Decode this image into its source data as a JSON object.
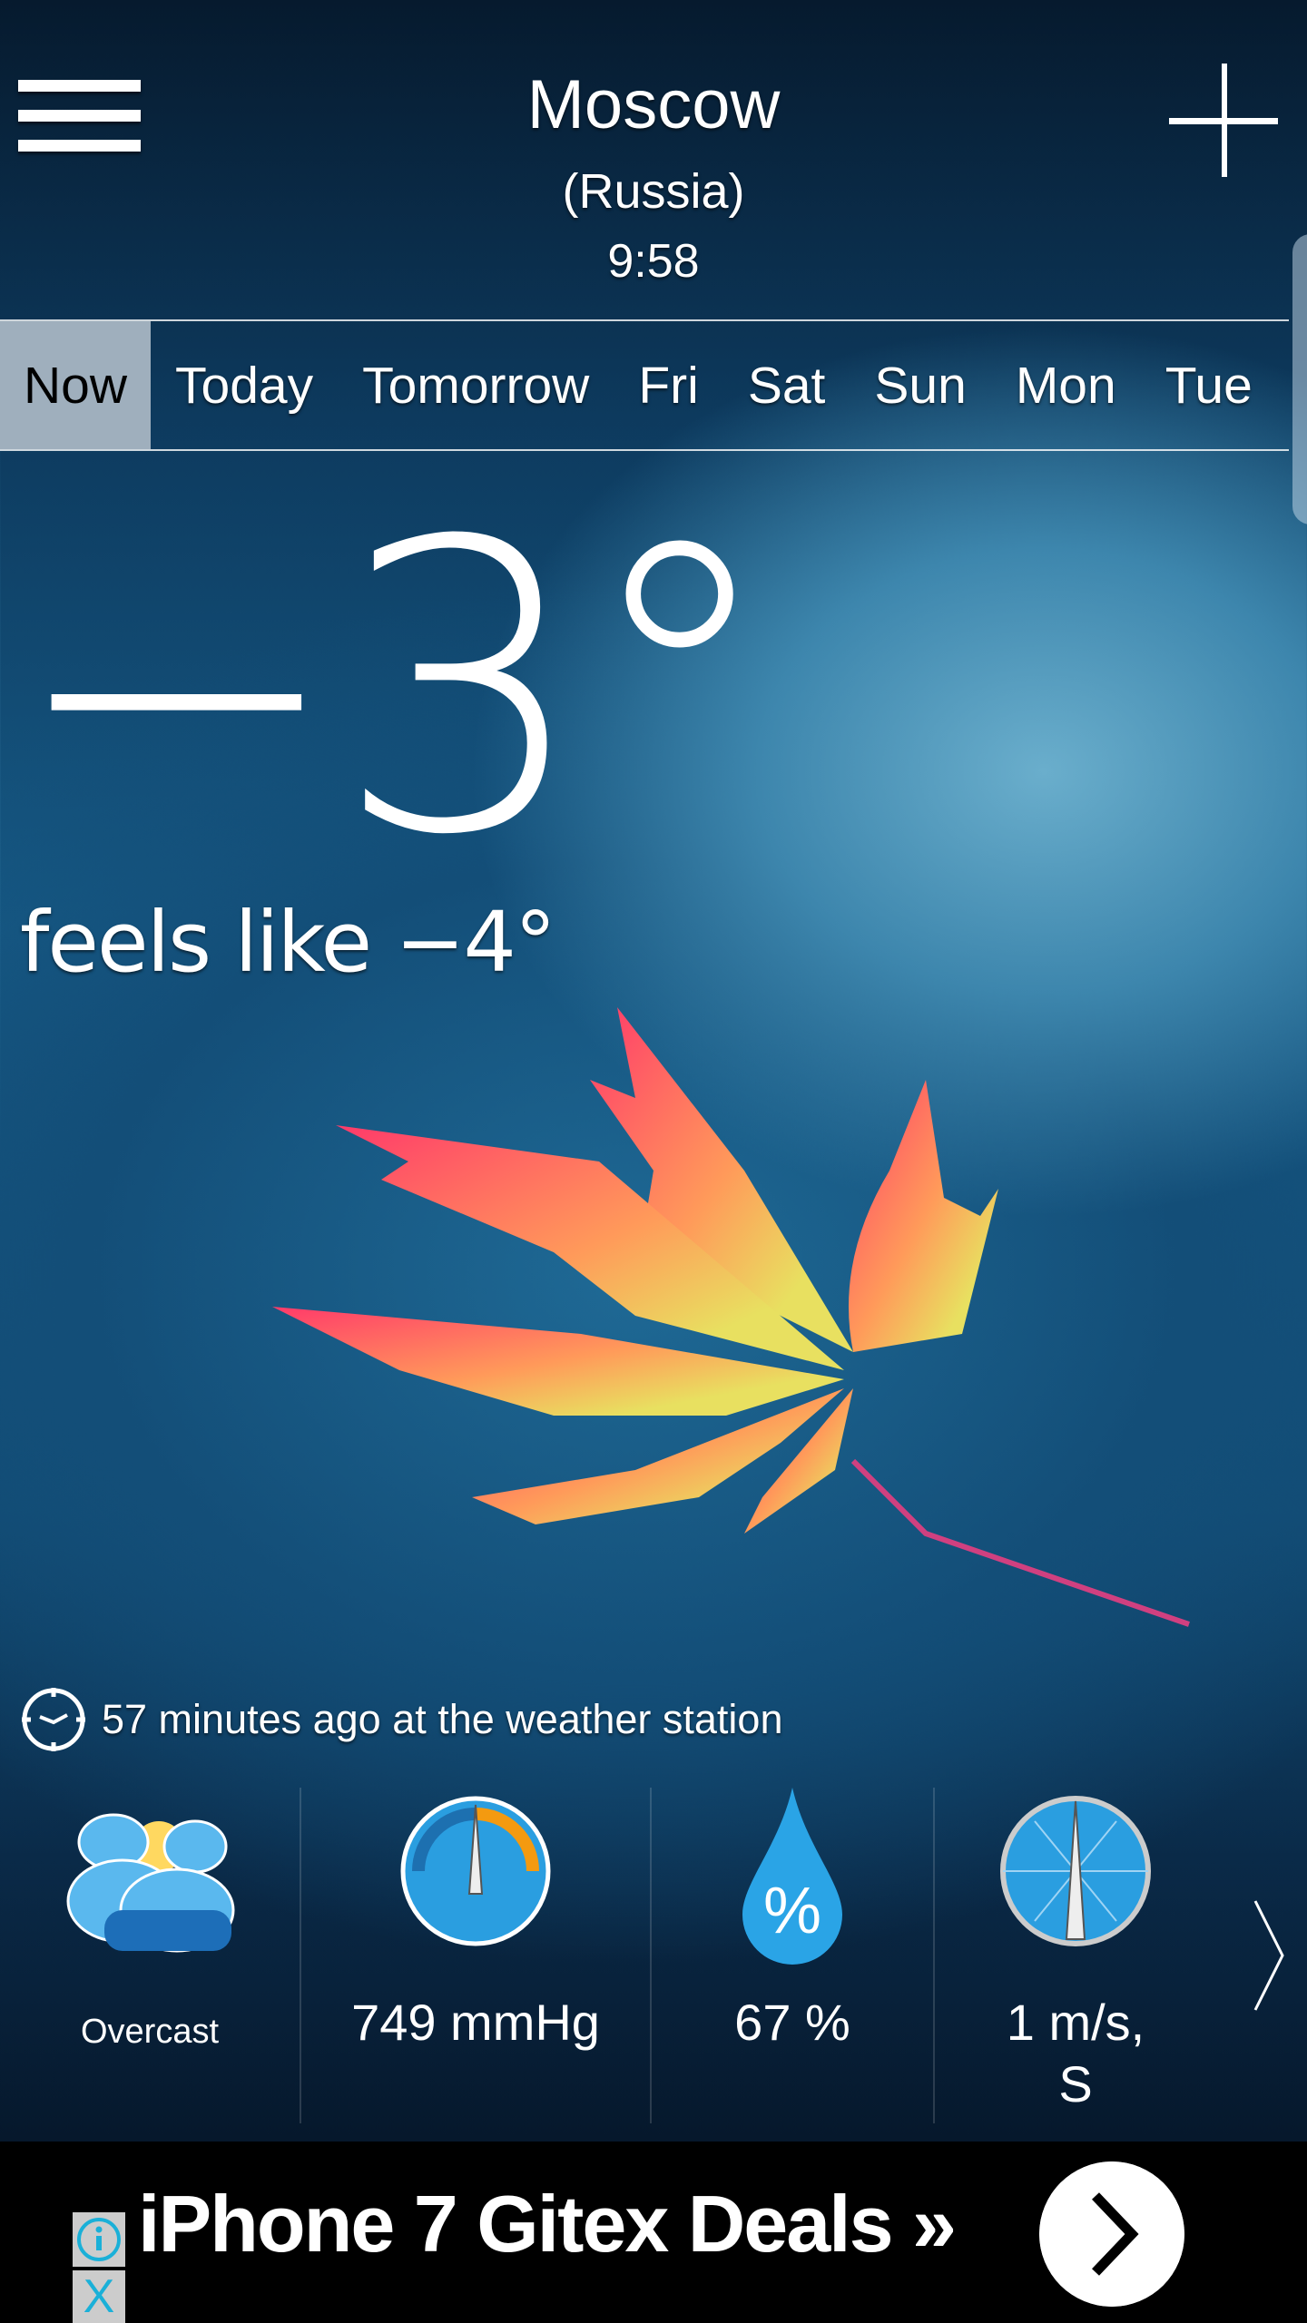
{
  "header": {
    "city": "Moscow",
    "country": "(Russia)",
    "time": "9:58"
  },
  "tabs": [
    "Now",
    "Today",
    "Tomorrow",
    "Fri",
    "Sat",
    "Sun",
    "Mon",
    "Tue"
  ],
  "active_tab": "Now",
  "current": {
    "temperature": "−3°",
    "feels_like": "feels like −4°",
    "updated": "57 minutes ago at the weather station"
  },
  "details": [
    {
      "icon": "overcast-cloud-icon",
      "value": "Overcast"
    },
    {
      "icon": "barometer-icon",
      "value": "749 mmHg"
    },
    {
      "icon": "humidity-drop-icon",
      "value": "67 %"
    },
    {
      "icon": "wind-compass-icon",
      "value": "1 m/s,",
      "value2": "S"
    }
  ],
  "ad": {
    "text": "iPhone 7 Gitex Deals »",
    "close": "X"
  },
  "colors": {
    "active_tab_bg": "#9fafbd",
    "ad_bg": "#000000",
    "info_accent": "#1ab0d8"
  }
}
